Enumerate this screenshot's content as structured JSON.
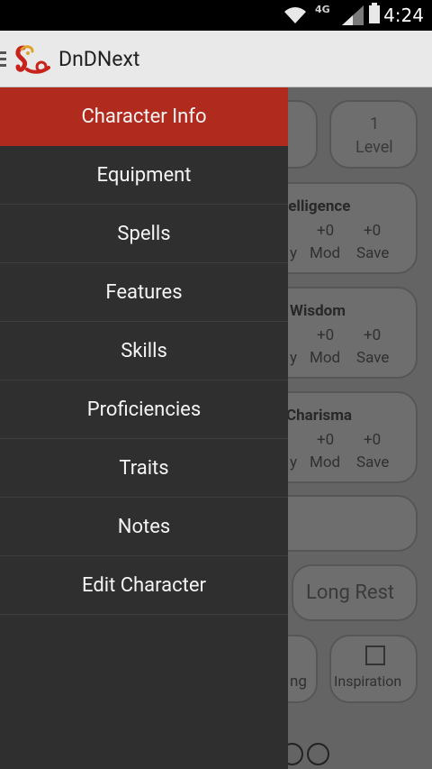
{
  "status_bar": {
    "time": "4:24",
    "network": "4G"
  },
  "app": {
    "title": "DnDNext"
  },
  "background": {
    "level": {
      "value": "1",
      "label": "Level"
    },
    "stats": [
      {
        "name": "Intelligence",
        "mod": "+0",
        "save": "+0",
        "mod_label": "Mod",
        "save_label": "Save",
        "partial": "y"
      },
      {
        "name": "Wisdom",
        "mod": "+0",
        "save": "+0",
        "mod_label": "Mod",
        "save_label": "Save",
        "partial": "y"
      },
      {
        "name": "Charisma",
        "mod": "+0",
        "save": "+0",
        "mod_label": "Mod",
        "save_label": "Save",
        "partial": "y"
      }
    ],
    "long_rest": "Long Rest",
    "partial_button": "ng",
    "inspiration": "Inspiration"
  },
  "drawer": {
    "items": [
      {
        "label": "Character Info",
        "active": true
      },
      {
        "label": "Equipment"
      },
      {
        "label": "Spells"
      },
      {
        "label": "Features"
      },
      {
        "label": "Skills"
      },
      {
        "label": "Proficiencies"
      },
      {
        "label": "Traits"
      },
      {
        "label": "Notes"
      },
      {
        "label": "Edit Character"
      }
    ]
  },
  "colors": {
    "accent": "#b12a1e",
    "drawer_bg": "#2f2f2f",
    "action_bar": "#e9e9e9"
  }
}
